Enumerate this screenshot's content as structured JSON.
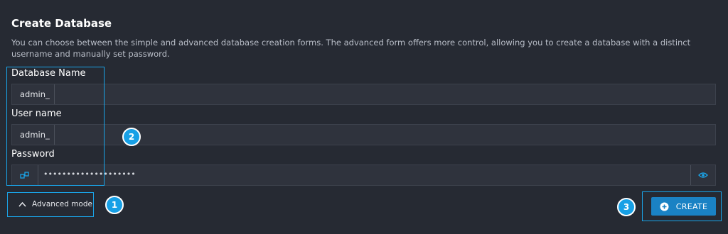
{
  "form": {
    "title": "Create Database",
    "description": "You can choose between the simple and advanced database creation forms. The advanced form offers more control, allowing you to create a database with a distinct username and manually set password.",
    "database_name": {
      "label": "Database Name",
      "prefix": "admin_",
      "value": ""
    },
    "user_name": {
      "label": "User name",
      "prefix": "admin_",
      "value": ""
    },
    "password": {
      "label": "Password",
      "masked_value": "••••••••••••••••••••"
    },
    "advanced_toggle_label": "Advanced mode",
    "create_button_label": "CREATE"
  },
  "annotations": {
    "badge_1": "1",
    "badge_2": "2",
    "badge_3": "3"
  },
  "colors": {
    "background": "#262a33",
    "input_background": "#2f333d",
    "accent": "#1aa4e8",
    "create_button": "#1a82c4"
  },
  "icons": [
    "key-icon",
    "eye-icon",
    "chevron-up-icon",
    "plus-circle-icon"
  ]
}
